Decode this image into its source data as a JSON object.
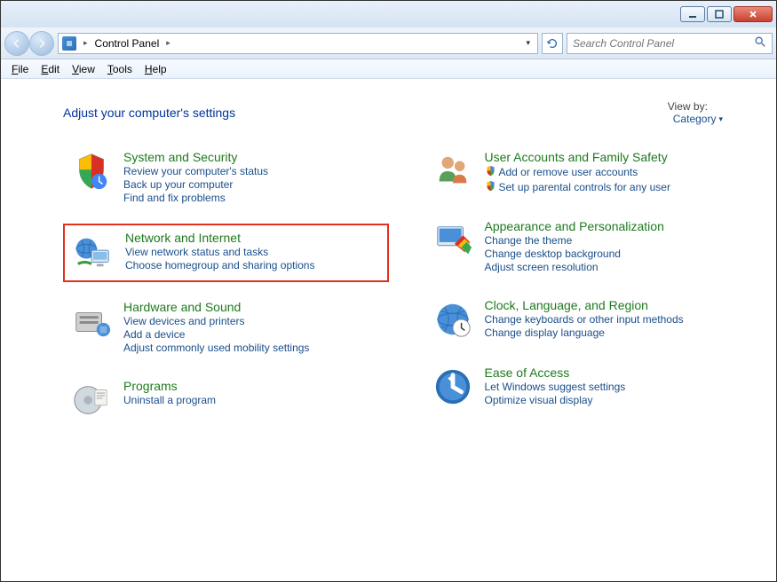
{
  "address": {
    "crumb1": "Control Panel"
  },
  "search": {
    "placeholder": "Search Control Panel"
  },
  "menu": {
    "file": "File",
    "edit": "Edit",
    "view": "View",
    "tools": "Tools",
    "help": "Help"
  },
  "header": {
    "title": "Adjust your computer's settings",
    "viewby_label": "View by:",
    "viewby_value": "Category"
  },
  "left": [
    {
      "title": "System and Security",
      "links": [
        {
          "text": "Review your computer's status"
        },
        {
          "text": "Back up your computer"
        },
        {
          "text": "Find and fix problems"
        }
      ]
    },
    {
      "title": "Network and Internet",
      "highlighted": true,
      "links": [
        {
          "text": "View network status and tasks"
        },
        {
          "text": "Choose homegroup and sharing options"
        }
      ]
    },
    {
      "title": "Hardware and Sound",
      "links": [
        {
          "text": "View devices and printers"
        },
        {
          "text": "Add a device"
        },
        {
          "text": "Adjust commonly used mobility settings"
        }
      ]
    },
    {
      "title": "Programs",
      "links": [
        {
          "text": "Uninstall a program"
        }
      ]
    }
  ],
  "right": [
    {
      "title": "User Accounts and Family Safety",
      "links": [
        {
          "text": "Add or remove user accounts",
          "shield": true
        },
        {
          "text": "Set up parental controls for any user",
          "shield": true
        }
      ]
    },
    {
      "title": "Appearance and Personalization",
      "links": [
        {
          "text": "Change the theme"
        },
        {
          "text": "Change desktop background"
        },
        {
          "text": "Adjust screen resolution"
        }
      ]
    },
    {
      "title": "Clock, Language, and Region",
      "links": [
        {
          "text": "Change keyboards or other input methods"
        },
        {
          "text": "Change display language"
        }
      ]
    },
    {
      "title": "Ease of Access",
      "links": [
        {
          "text": "Let Windows suggest settings"
        },
        {
          "text": "Optimize visual display"
        }
      ]
    }
  ]
}
